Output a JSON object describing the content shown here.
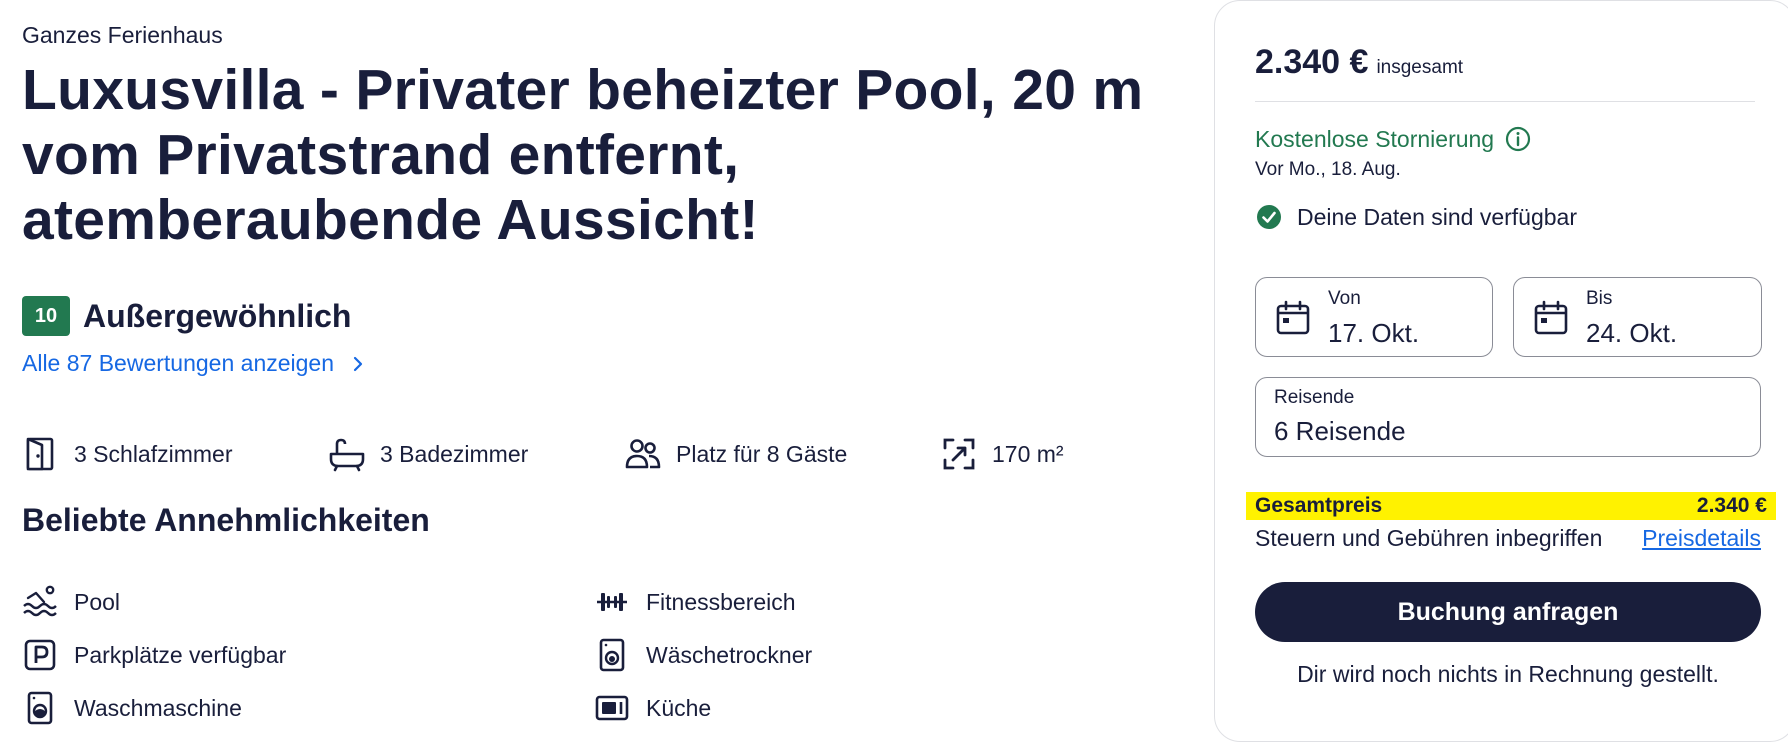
{
  "listing": {
    "type": "Ganzes Ferienhaus",
    "title": "Luxusvilla - Privater beheizter Pool, 20 m vom Privatstrand entfernt, atemberaubende Aussicht!",
    "rating": {
      "score": "10",
      "label": "Außergewöhnlich",
      "reviews_link": "Alle 87 Bewertungen anzeigen"
    },
    "facts": [
      {
        "icon": "door-icon",
        "label": "3 Schlafzimmer"
      },
      {
        "icon": "bathtub-icon",
        "label": "3 Badezimmer"
      },
      {
        "icon": "guests-icon",
        "label": "Platz für 8 Gäste"
      },
      {
        "icon": "area-icon",
        "label": "170 m²"
      }
    ],
    "amenities_title": "Beliebte Annehmlichkeiten",
    "amenities": [
      {
        "icon": "pool-icon",
        "label": "Pool"
      },
      {
        "icon": "fitness-icon",
        "label": "Fitnessbereich"
      },
      {
        "icon": "parking-icon",
        "label": "Parkplätze verfügbar"
      },
      {
        "icon": "dryer-icon",
        "label": "Wäschetrockner"
      },
      {
        "icon": "washer-icon",
        "label": "Waschmaschine"
      },
      {
        "icon": "kitchen-icon",
        "label": "Küche"
      }
    ]
  },
  "booking": {
    "price": "2.340 €",
    "price_note": "insgesamt",
    "cancellation": "Kostenlose Stornierung",
    "cancellation_deadline": "Vor Mo., 18. Aug.",
    "availability": "Deine Daten sind verfügbar",
    "checkin": {
      "label": "Von",
      "value": "17. Okt."
    },
    "checkout": {
      "label": "Bis",
      "value": "24. Okt."
    },
    "travelers": {
      "label": "Reisende",
      "value": "6 Reisende"
    },
    "total_label": "Gesamtpreis",
    "total_value": "2.340 €",
    "taxes_note": "Steuern und Gebühren inbegriffen",
    "price_details_link": "Preisdetails",
    "book_button": "Buchung anfragen",
    "no_charge_note": "Dir wird noch nichts in Rechnung gestellt."
  },
  "colors": {
    "text": "#191e3b",
    "link": "#1668e3",
    "success": "#227950",
    "highlight": "#fff200"
  }
}
